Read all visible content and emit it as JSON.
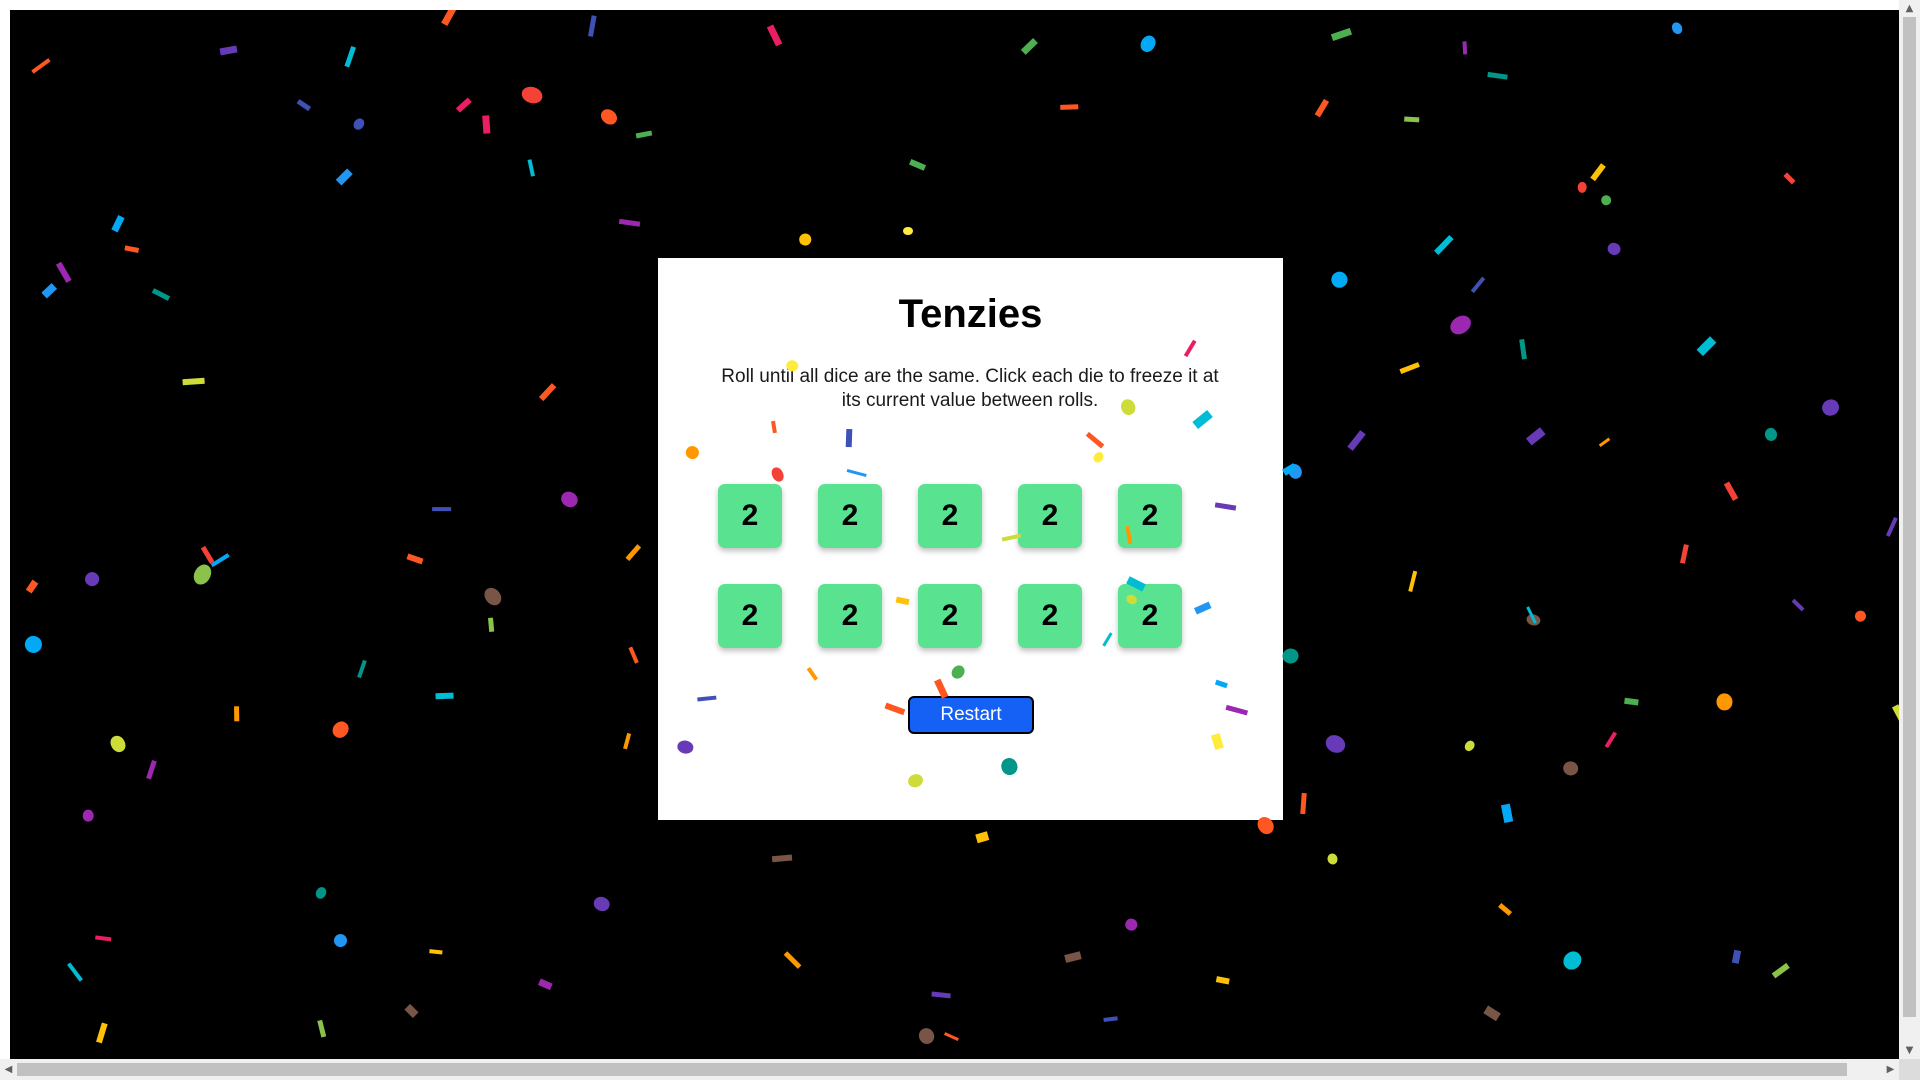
{
  "game": {
    "title": "Tenzies",
    "instructions": "Roll until all dice are the same. Click each die to freeze it at its current value between rolls.",
    "dice": [
      "2",
      "2",
      "2",
      "2",
      "2",
      "2",
      "2",
      "2",
      "2",
      "2"
    ],
    "die_held": [
      false,
      false,
      false,
      false,
      false,
      false,
      false,
      false,
      false,
      false
    ],
    "restart_label": "Restart",
    "won": true
  },
  "colors": {
    "background": "#000000",
    "card": "#ffffff",
    "die": "#59e391",
    "button": "#1560f5",
    "confetti_palette": [
      "#f44336",
      "#e91e63",
      "#9c27b0",
      "#673ab7",
      "#3f51b5",
      "#2196f3",
      "#03a9f4",
      "#00bcd4",
      "#009688",
      "#4caf50",
      "#8bc34a",
      "#cddc39",
      "#ffeb3b",
      "#ffc107",
      "#ff9800",
      "#ff5722",
      "#795548"
    ]
  },
  "icons": {
    "scroll_up": "▲",
    "scroll_down": "▼",
    "scroll_left": "◀",
    "scroll_right": "▶"
  }
}
